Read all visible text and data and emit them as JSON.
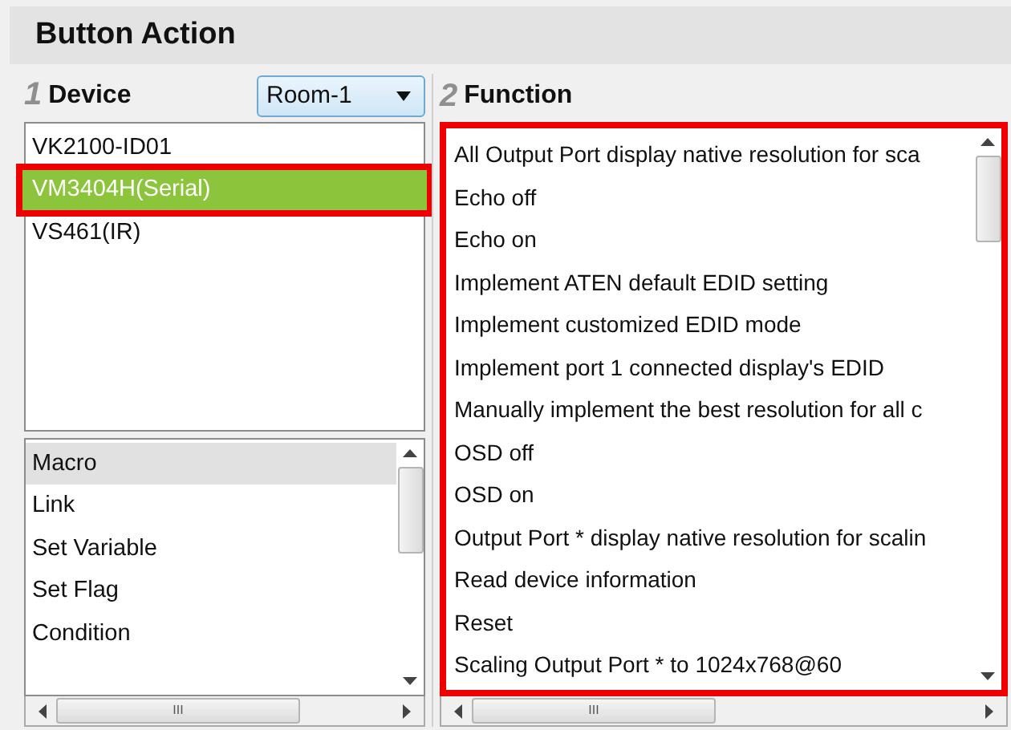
{
  "panel": {
    "title": "Button Action"
  },
  "device_section": {
    "step": "1",
    "heading": "Device",
    "dropdown": {
      "value": "Room-1"
    }
  },
  "function_section": {
    "step": "2",
    "heading": "Function"
  },
  "devices": [
    {
      "label": "VK2100-ID01",
      "selected": false
    },
    {
      "label": "VM3404H(Serial)",
      "selected": true
    },
    {
      "label": "VS461(IR)",
      "selected": false
    }
  ],
  "commands": [
    {
      "label": "Macro",
      "selected": true
    },
    {
      "label": "Link",
      "selected": false
    },
    {
      "label": "Set Variable",
      "selected": false
    },
    {
      "label": "Set Flag",
      "selected": false
    },
    {
      "label": "Condition",
      "selected": false
    }
  ],
  "functions": [
    {
      "label": "All Output Port display native resolution for sca"
    },
    {
      "label": "Echo off"
    },
    {
      "label": "Echo on"
    },
    {
      "label": "Implement ATEN default EDID setting"
    },
    {
      "label": "Implement customized EDID mode"
    },
    {
      "label": "Implement port 1 connected display's EDID"
    },
    {
      "label": "Manually implement the best resolution for all c"
    },
    {
      "label": "OSD off"
    },
    {
      "label": "OSD on"
    },
    {
      "label": "Output Port * display native resolution for scalin"
    },
    {
      "label": "Read device information"
    },
    {
      "label": "Reset"
    },
    {
      "label": "Scaling Output Port * to 1024x768@60"
    }
  ],
  "scroll_thumb_glyphs": [
    "III",
    "III"
  ]
}
